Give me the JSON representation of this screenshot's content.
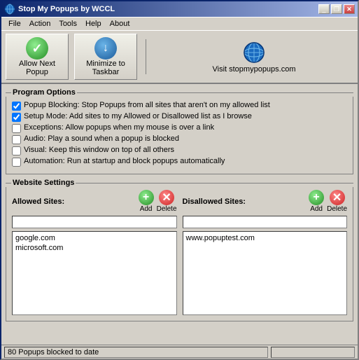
{
  "window": {
    "title": "Stop My Popups by WCCL"
  },
  "menu": {
    "items": [
      {
        "label": "File"
      },
      {
        "label": "Action"
      },
      {
        "label": "Tools"
      },
      {
        "label": "Help"
      },
      {
        "label": "About"
      }
    ]
  },
  "toolbar": {
    "allow_next_popup": "Allow Next\nPopup",
    "allow_line1": "Allow Next",
    "allow_line2": "Popup",
    "minimize_line1": "Minimize to",
    "minimize_line2": "Taskbar",
    "visit_label": "Visit stopmypopups.com"
  },
  "program_options": {
    "title": "Program Options",
    "checkboxes": [
      {
        "id": "cb1",
        "checked": true,
        "label": "Popup Blocking: Stop Popups from all sites that aren't on my allowed list"
      },
      {
        "id": "cb2",
        "checked": true,
        "label": "Setup Mode: Add sites to my Allowed or Disallowed list as I browse"
      },
      {
        "id": "cb3",
        "checked": false,
        "label": "Exceptions: Allow popups when my mouse is over a link"
      },
      {
        "id": "cb4",
        "checked": false,
        "label": "Audio: Play a sound when a popup is blocked"
      },
      {
        "id": "cb5",
        "checked": false,
        "label": "Visual: Keep this window on top of all others"
      },
      {
        "id": "cb6",
        "checked": false,
        "label": "Automation: Run at startup and block popups automatically"
      }
    ]
  },
  "website_settings": {
    "title": "Website Settings",
    "allowed": {
      "label": "Allowed Sites:",
      "add_label": "Add",
      "delete_label": "Delete",
      "input_value": "",
      "sites": [
        {
          "name": "google.com"
        },
        {
          "name": "microsoft.com"
        }
      ]
    },
    "disallowed": {
      "label": "Disallowed Sites:",
      "add_label": "Add",
      "delete_label": "Delete",
      "input_value": "",
      "sites": [
        {
          "name": "www.popuptest.com"
        }
      ]
    }
  },
  "status_bar": {
    "text": "80 Popups blocked to date"
  },
  "icons": {
    "checkmark": "✓",
    "arrow_down": "↓",
    "add": "+",
    "delete": "✕",
    "minimize": "_",
    "close": "✕",
    "restore": "❐"
  }
}
